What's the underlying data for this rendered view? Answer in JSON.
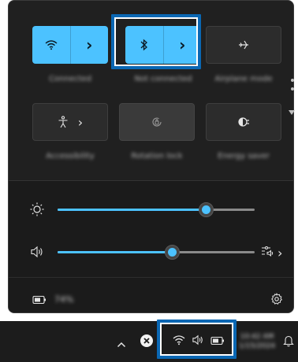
{
  "quick_settings": {
    "tiles": [
      {
        "id": "wifi",
        "label": "Connected",
        "state": "on",
        "icon": "wifi-icon",
        "has_arrow": true
      },
      {
        "id": "bluetooth",
        "label": "Not connected",
        "state": "on",
        "icon": "bluetooth-icon",
        "has_arrow": true
      },
      {
        "id": "airplane",
        "label": "Airplane mode",
        "state": "off",
        "icon": "airplane-icon",
        "has_arrow": false
      },
      {
        "id": "accessibility",
        "label": "Accessibility",
        "state": "off",
        "icon": "accessibility-icon",
        "has_arrow": true
      },
      {
        "id": "rotation",
        "label": "Rotation lock",
        "state": "disabled",
        "icon": "rotation-lock-icon",
        "has_arrow": false
      },
      {
        "id": "energy",
        "label": "Energy saver",
        "state": "off",
        "icon": "energy-saver-icon",
        "has_arrow": false
      }
    ],
    "chevron": "›",
    "brightness": {
      "value_percent": 75,
      "icon": "brightness-icon"
    },
    "volume": {
      "value_percent": 58,
      "icon": "speaker-icon",
      "output_icon": "audio-output-icon"
    },
    "battery": {
      "label": "74%",
      "icon": "battery-icon"
    },
    "settings_icon": "gear-icon"
  },
  "taskbar": {
    "overflow_icon": "chevron-up-icon",
    "close_icon": "close-circle-icon",
    "tray_icons": [
      "wifi-icon",
      "speaker-icon",
      "battery-icon"
    ],
    "clock_time": "10:42 AM",
    "clock_date": "1/15/2024",
    "notification_icon": "bell-icon"
  },
  "colors": {
    "accent": "#4cc2ff",
    "highlight": "#0a67b3",
    "panel": "#202020"
  }
}
